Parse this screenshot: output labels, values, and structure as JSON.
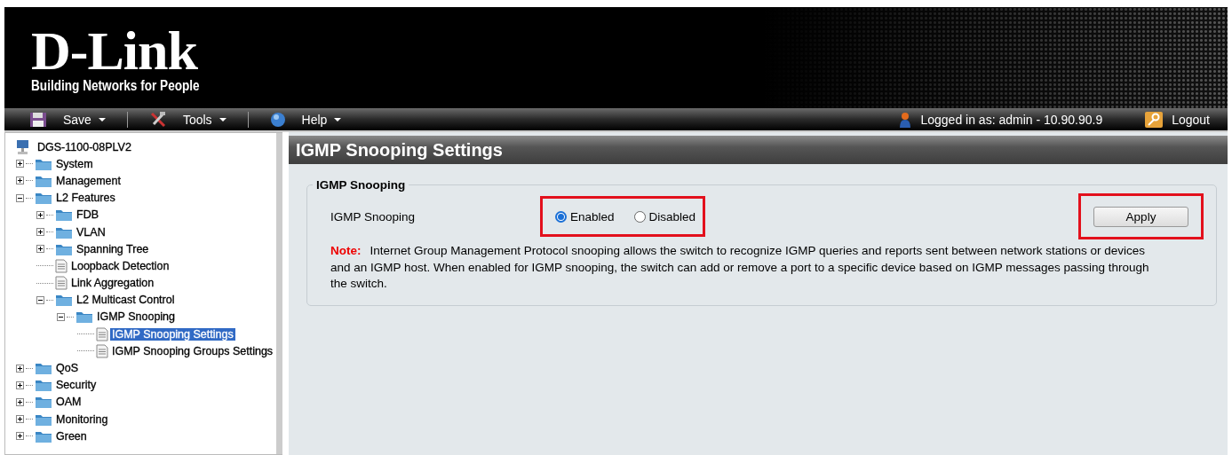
{
  "header": {
    "logo": "D-Link",
    "tagline": "Building Networks for People"
  },
  "toolbar": {
    "menus": [
      {
        "label": "Save",
        "kind": "save"
      },
      {
        "label": "Tools",
        "kind": "tools"
      },
      {
        "label": "Help",
        "kind": "help"
      }
    ],
    "user": "Logged in as: admin - 10.90.90.9",
    "logout": "Logout"
  },
  "tree": {
    "label": "DGS-1100-08PLV2",
    "children": [
      {
        "label": "System",
        "kind": "folder",
        "expanded": false,
        "selected": false
      },
      {
        "label": "Management",
        "kind": "folder",
        "expanded": false,
        "selected": false
      },
      {
        "label": "L2 Features",
        "kind": "folder",
        "expanded": true,
        "selected": false,
        "children": [
          {
            "label": "FDB",
            "kind": "folder",
            "expanded": false,
            "selected": false
          },
          {
            "label": "VLAN",
            "kind": "folder",
            "expanded": false,
            "selected": false
          },
          {
            "label": "Spanning Tree",
            "kind": "folder",
            "expanded": false,
            "selected": false
          },
          {
            "label": "Loopback Detection",
            "kind": "page",
            "selected": false
          },
          {
            "label": "Link Aggregation",
            "kind": "page",
            "selected": false
          },
          {
            "label": "L2 Multicast Control",
            "kind": "folder",
            "expanded": true,
            "selected": false,
            "children": [
              {
                "label": "IGMP Snooping",
                "kind": "folder",
                "expanded": true,
                "selected": false,
                "children": [
                  {
                    "label": "IGMP Snooping Settings",
                    "kind": "page",
                    "selected": true
                  },
                  {
                    "label": "IGMP Snooping Groups Settings",
                    "kind": "page",
                    "selected": false
                  }
                ]
              }
            ]
          }
        ]
      },
      {
        "label": "QoS",
        "kind": "folder",
        "expanded": false,
        "selected": false
      },
      {
        "label": "Security",
        "kind": "folder",
        "expanded": false,
        "selected": false
      },
      {
        "label": "OAM",
        "kind": "folder",
        "expanded": false,
        "selected": false
      },
      {
        "label": "Monitoring",
        "kind": "folder",
        "expanded": false,
        "selected": false
      },
      {
        "label": "Green",
        "kind": "folder",
        "expanded": false,
        "selected": false
      }
    ]
  },
  "page": {
    "title": "IGMP Snooping Settings",
    "group": "IGMP Snooping",
    "field_label": "IGMP Snooping",
    "options": [
      {
        "label": "Enabled",
        "selected": true
      },
      {
        "label": "Disabled",
        "selected": false
      }
    ],
    "options_highlighted": true,
    "apply": "Apply",
    "apply_highlighted": true,
    "note_label": "Note:",
    "note": "Internet Group Management Protocol snooping allows the switch to recognize IGMP queries and reports sent between network stations or devices and an IGMP host. When enabled for IGMP snooping, the switch can add or remove a port to a specific device based on IGMP messages passing through the switch."
  }
}
